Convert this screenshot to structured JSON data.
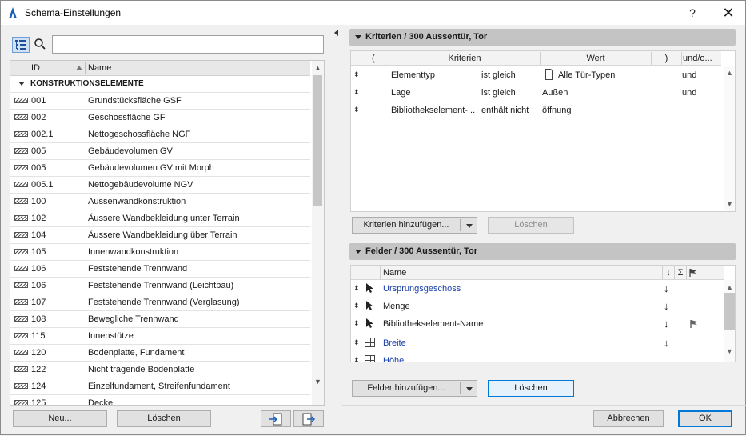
{
  "window": {
    "title": "Schema-Einstellungen",
    "help": "?",
    "close": "✕"
  },
  "left": {
    "search_placeholder": "",
    "columns": {
      "id": "ID",
      "name": "Name"
    },
    "group": "KONSTRUKTIONSELEMENTE",
    "rows": [
      {
        "id": "001",
        "name": "Grundstücksfläche GSF"
      },
      {
        "id": "002",
        "name": "Geschossfläche GF"
      },
      {
        "id": "002.1",
        "name": "Nettogeschossfläche NGF"
      },
      {
        "id": "005",
        "name": "Gebäudevolumen GV"
      },
      {
        "id": "005",
        "name": "Gebäudevolumen GV mit Morph"
      },
      {
        "id": "005.1",
        "name": "Nettogebäudevolume NGV"
      },
      {
        "id": "100",
        "name": "Aussenwandkonstruktion"
      },
      {
        "id": "102",
        "name": "Äussere Wandbekleidung unter Terrain"
      },
      {
        "id": "104",
        "name": "Äussere Wandbekleidung über Terrain"
      },
      {
        "id": "105",
        "name": "Innenwandkonstruktion"
      },
      {
        "id": "106",
        "name": "Feststehende Trennwand"
      },
      {
        "id": "106",
        "name": "Feststehende Trennwand (Leichtbau)"
      },
      {
        "id": "107",
        "name": "Feststehende Trennwand (Verglasung)"
      },
      {
        "id": "108",
        "name": "Bewegliche Trennwand"
      },
      {
        "id": "115",
        "name": "Innenstütze"
      },
      {
        "id": "120",
        "name": "Bodenplatte, Fundament"
      },
      {
        "id": "122",
        "name": "Nicht tragende Bodenplatte"
      },
      {
        "id": "124",
        "name": "Einzelfundament, Streifenfundament"
      },
      {
        "id": "125",
        "name": "Decke"
      }
    ],
    "buttons": {
      "new": "Neu...",
      "delete": "Löschen"
    }
  },
  "criteria": {
    "title": "Kriterien / 300 Aussentür, Tor",
    "columns": {
      "open": "(",
      "criteria": "Kriterien",
      "value": "Wert",
      "close": ")",
      "andor": "und/o..."
    },
    "rows": [
      {
        "criterion": "Elementtyp",
        "operator": "ist gleich",
        "value": "Alle Tür-Typen",
        "andor": "und"
      },
      {
        "criterion": "Lage",
        "operator": "ist gleich",
        "value": "Außen",
        "andor": "und"
      },
      {
        "criterion": "Bibliothekselement-...",
        "operator": "enthält nicht",
        "value": "öffnung",
        "andor": ""
      }
    ],
    "add_button": "Kriterien hinzufügen...",
    "delete_button": "Löschen"
  },
  "fields": {
    "title": "Felder / 300 Aussentür, Tor",
    "columns": {
      "name": "Name",
      "sort": "↓",
      "sum": "Σ"
    },
    "rows": [
      {
        "name": "Ursprungsgeschoss",
        "sort": "↓",
        "blue": true
      },
      {
        "name": "Menge",
        "sort": "↓",
        "blue": false
      },
      {
        "name": "Bibliothekselement-Name",
        "sort": "↓",
        "blue": false
      },
      {
        "name": "Breite",
        "sort": "↓",
        "blue": true
      },
      {
        "name": "Höhe",
        "sort": "",
        "blue": true
      }
    ],
    "add_button": "Felder hinzufügen...",
    "delete_button": "Löschen"
  },
  "footer": {
    "cancel": "Abbrechen",
    "ok": "OK"
  }
}
